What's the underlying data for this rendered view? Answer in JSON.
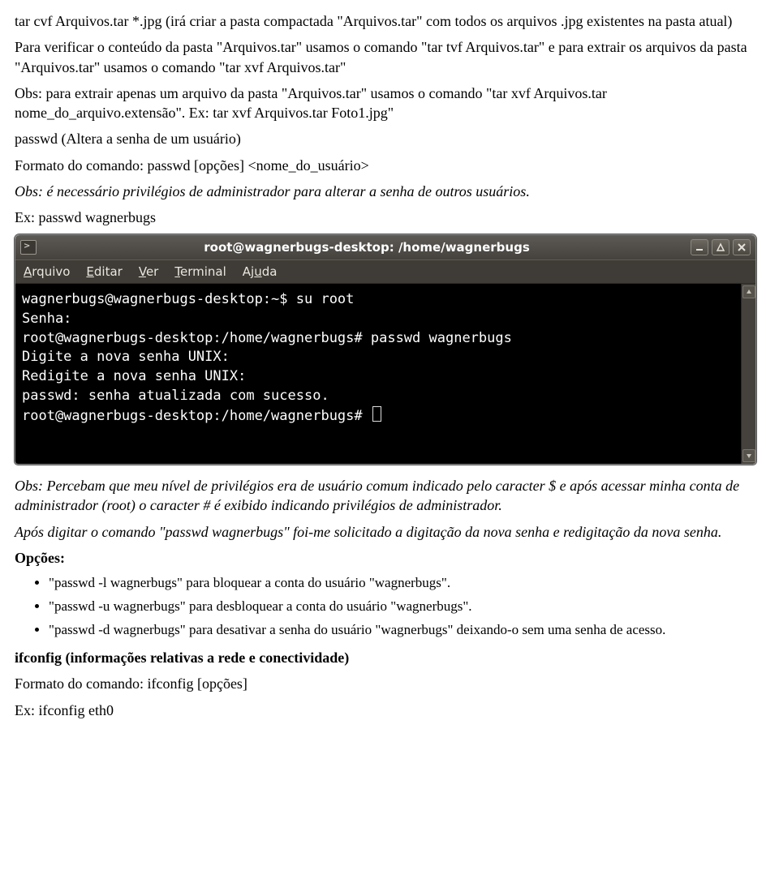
{
  "para1": "tar cvf Arquivos.tar *.jpg (irá criar a pasta compactada \"Arquivos.tar\" com todos os arquivos .jpg existentes na pasta atual)",
  "para2": "Para verificar o conteúdo da pasta \"Arquivos.tar\" usamos o comando \"tar tvf Arquivos.tar\" e para extrair os arquivos da pasta \"Arquivos.tar\" usamos o comando \"tar xvf Arquivos.tar\"",
  "para3": "Obs: para extrair apenas um arquivo da pasta \"Arquivos.tar\" usamos o comando \"tar xvf Arquivos.tar nome_do_arquivo.extensão\". Ex: tar xvf Arquivos.tar Foto1.jpg\"",
  "para4": "passwd (Altera a senha de um usuário)",
  "para5": "Formato do comando: passwd [opções] <nome_do_usuário>",
  "para6": "Obs: é necessário privilégios de administrador para alterar a senha de outros usuários.",
  "para7": "Ex: passwd wagnerbugs",
  "terminal": {
    "title": "root@wagnerbugs-desktop: /home/wagnerbugs",
    "menus": {
      "arquivo": "Arquivo",
      "editar": "Editar",
      "ver": "Ver",
      "terminal": "Terminal",
      "ajuda": "Ajuda"
    },
    "lines": {
      "l1": "wagnerbugs@wagnerbugs-desktop:~$ su root",
      "l2": "Senha:",
      "l3": "root@wagnerbugs-desktop:/home/wagnerbugs# passwd wagnerbugs",
      "l4": "Digite a nova senha UNIX:",
      "l5": "Redigite a nova senha UNIX:",
      "l6": "passwd: senha atualizada com sucesso.",
      "l7": "root@wagnerbugs-desktop:/home/wagnerbugs# "
    }
  },
  "para8": "Obs: Percebam que meu nível de privilégios era de usuário comum indicado pelo caracter $ e após acessar minha conta de administrador (root) o caracter # é exibido indicando privilégios de administrador.",
  "para9": "Após digitar o comando \"passwd wagnerbugs\" foi-me solicitado a digitação da nova senha e redigitação da nova senha.",
  "options_label": "Opções:",
  "options": {
    "o1": "\"passwd -l wagnerbugs\" para bloquear a conta do usuário \"wagnerbugs\".",
    "o2": "\"passwd -u wagnerbugs\" para desbloquear a conta do usuário \"wagnerbugs\".",
    "o3": "\"passwd -d wagnerbugs\" para desativar a senha do usuário \"wagnerbugs\" deixando-o sem uma senha de acesso."
  },
  "ifconfig_heading": "ifconfig (informações relativas a rede e conectividade)",
  "ifconfig_format": "Formato do comando: ifconfig [opções]",
  "ifconfig_ex": "Ex: ifconfig eth0"
}
